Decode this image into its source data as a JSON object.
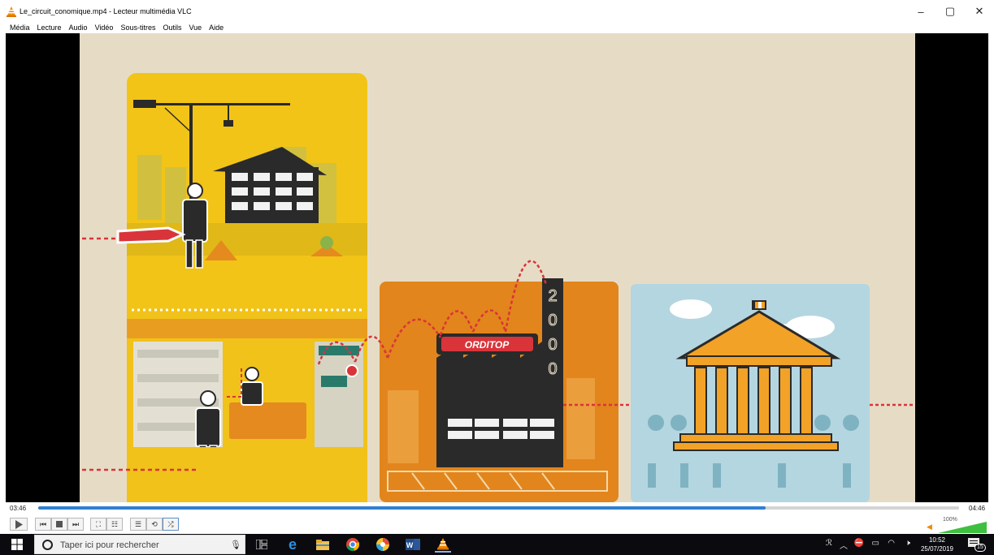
{
  "window": {
    "title": "Le_circuit_conomique.mp4 - Lecteur multimédia VLC",
    "controls": [
      "–",
      "▢",
      "✕"
    ]
  },
  "menu": [
    "Média",
    "Lecture",
    "Audio",
    "Vidéo",
    "Sous-titres",
    "Outils",
    "Vue",
    "Aide"
  ],
  "video": {
    "factory_sign": "ORDITOP",
    "chimney_digits": [
      "2",
      "0",
      "0",
      "0"
    ],
    "colors": {
      "background": "#e6dcc6",
      "panel_yellow": "#f2c417",
      "panel_orange": "#e2851c",
      "panel_blue": "#b4d6e1",
      "dashed_red": "#d9343a",
      "dark": "#2a2a2a"
    }
  },
  "playback": {
    "elapsed": "03:46",
    "total": "04:46",
    "progress": 0.79,
    "volume_label": "100%",
    "volume": 1.0
  },
  "control_buttons": {
    "play": "play-icon",
    "prev": "previous-icon",
    "stop": "stop-icon",
    "next": "next-icon",
    "fullscreen": "fullscreen-icon",
    "extended": "equalizer-icon",
    "playlist": "playlist-icon",
    "loop": "loop-icon",
    "random": "shuffle-icon"
  },
  "taskbar": {
    "search_placeholder": "Taper ici pour rechercher",
    "clock_time": "10:52",
    "clock_date": "25/07/2019",
    "notification_count": "15",
    "tray_icons": [
      "people-icon",
      "chevron-up-icon",
      "network-icon",
      "battery-icon",
      "wifi-icon",
      "speaker-muted-icon"
    ],
    "apps": [
      "task-view-icon",
      "edge-icon",
      "file-explorer-icon",
      "chrome-icon",
      "photos-icon",
      "word-icon",
      "vlc-icon"
    ]
  }
}
